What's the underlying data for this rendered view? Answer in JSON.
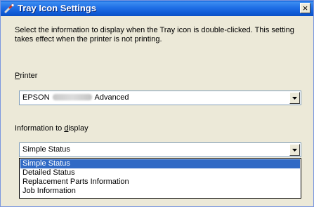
{
  "window": {
    "title": "Tray Icon Settings",
    "close_symbol": "×",
    "icon": "wrench-icon"
  },
  "description": "Select the information to display when the Tray icon is double-clicked. This setting takes effect when the printer is not printing.",
  "printer": {
    "label_mnemonic": "P",
    "label_rest": "rinter",
    "value_prefix": "EPSON",
    "value_suffix": "Advanced"
  },
  "info_display": {
    "label_prefix": "Information to ",
    "label_mnemonic": "d",
    "label_rest": "isplay",
    "value": "Simple Status",
    "options": [
      "Simple Status",
      "Detailed Status",
      "Replacement Parts Information",
      "Job Information"
    ],
    "selected_index": 0
  },
  "colors": {
    "title_bar": "#0a5fd8",
    "selection": "#316ac5",
    "dialog_bg": "#ece9d8"
  }
}
